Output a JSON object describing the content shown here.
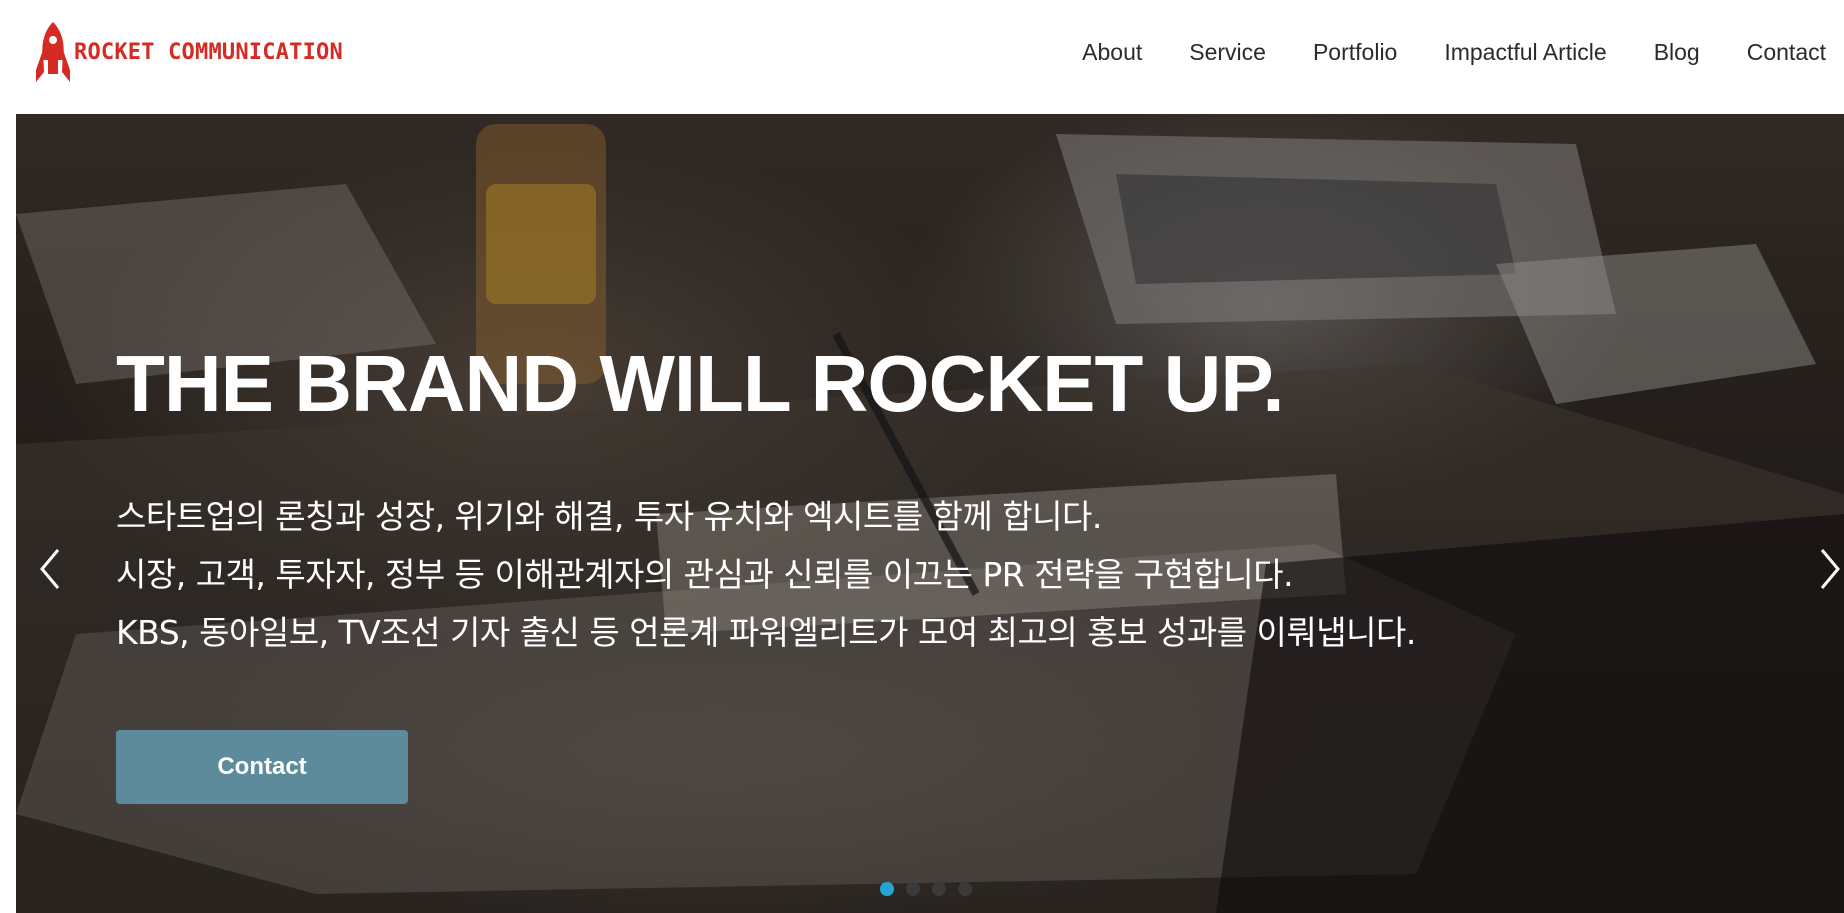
{
  "brand": {
    "name": "ROCKET COMMUNICATION",
    "logo_icon": "rocket-icon",
    "color": "#d62a25"
  },
  "nav": {
    "items": [
      {
        "label": "About"
      },
      {
        "label": "Service"
      },
      {
        "label": "Portfolio"
      },
      {
        "label": "Impactful Article"
      },
      {
        "label": "Blog"
      },
      {
        "label": "Contact"
      }
    ]
  },
  "hero": {
    "headline": "THE BRAND WILL ROCKET UP.",
    "lines": [
      "스타트업의 론칭과 성장, 위기와 해결, 투자 유치와 엑시트를 함께 합니다.",
      "시장, 고객, 투자자, 정부 등 이해관계자의 관심과 신뢰를 이끄는 PR 전략을 구현합니다.",
      "KBS, 동아일보, TV조선 기자 출신 등 언론계 파워엘리트가 모여 최고의 홍보 성과를 이뤄냅니다."
    ],
    "cta_label": "Contact",
    "cta_color": "#5e8b9b",
    "prev_icon": "chevron-left-icon",
    "next_icon": "chevron-right-icon"
  },
  "carousel": {
    "slide_count": 4,
    "active_index": 0,
    "active_color": "#27a4d6"
  }
}
